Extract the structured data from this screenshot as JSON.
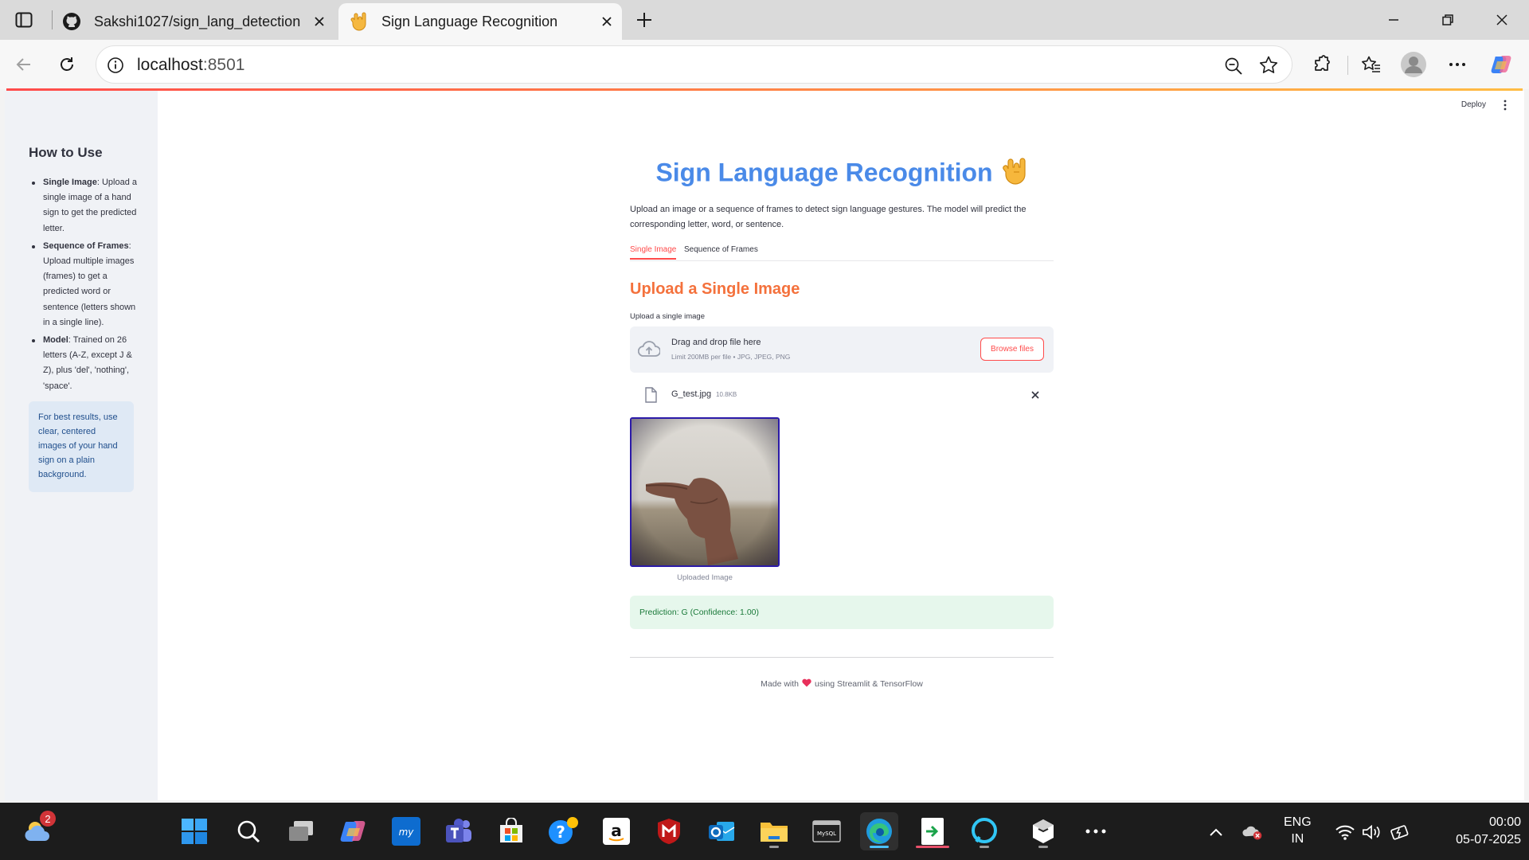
{
  "browser": {
    "tabs": [
      {
        "title": "Sakshi1027/sign_lang_detection",
        "icon": "github-icon"
      },
      {
        "title": "Sign Language Recognition",
        "icon": "hand-emoji-icon"
      }
    ],
    "url_host": "localhost",
    "url_port": ":8501"
  },
  "sidebar": {
    "title": "How to Use",
    "items": [
      {
        "label": "Single Image",
        "text": ": Upload a single image of a hand sign to get the predicted letter."
      },
      {
        "label": "Sequence of Frames",
        "text": ": Upload multiple images (frames) to get a predicted word or sentence (letters shown in a single line)."
      },
      {
        "label": "Model",
        "text": ": Trained on 26 letters (A-Z, except J & Z), plus 'del', 'nothing', 'space'."
      }
    ],
    "info": "For best results, use clear, centered images of your hand sign on a plain background."
  },
  "header": {
    "deploy": "Deploy"
  },
  "main": {
    "title": "Sign Language Recognition",
    "title_emoji": "🤟",
    "intro": "Upload an image or a sequence of frames to detect sign language gestures. The model will predict the corresponding letter, word, or sentence.",
    "tabs": [
      "Single Image",
      "Sequence of Frames"
    ],
    "section_title": "Upload a Single Image",
    "upload_label": "Upload a single image",
    "dropzone_main": "Drag and drop file here",
    "dropzone_sub": "Limit 200MB per file • JPG, JPEG, PNG",
    "browse": "Browse files",
    "file_name": "G_test.jpg",
    "file_size": "10.8KB",
    "caption": "Uploaded Image",
    "prediction": "Prediction: G (Confidence: 1.00)",
    "footer_pre": "Made with",
    "footer_post": "using Streamlit & TensorFlow"
  },
  "taskbar": {
    "weather_badge": "2",
    "lang_top": "ENG",
    "lang_bottom": "IN",
    "time": "00:00",
    "date": "05-07-2025"
  },
  "colors": {
    "title": "#4a8ae8",
    "section": "#f4713c",
    "accent": "#ff4b4b",
    "success_bg": "#e6f7ec",
    "info_bg": "#dfe9f5"
  }
}
